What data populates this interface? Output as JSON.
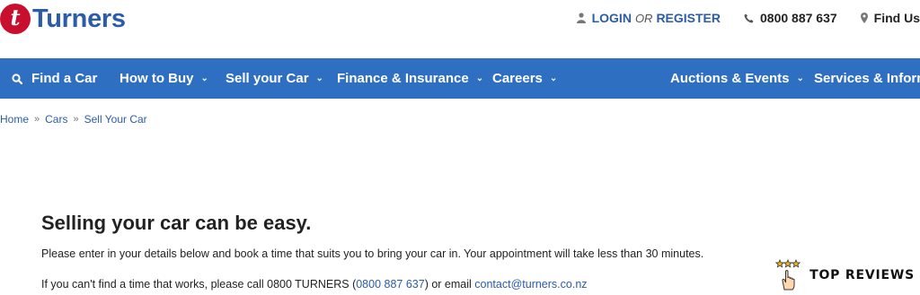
{
  "brand": {
    "name": "Turners",
    "mark": "t",
    "color": "#c8102e",
    "text_color": "#2a5caa"
  },
  "header": {
    "login": "LOGIN",
    "or": "OR",
    "register": "REGISTER",
    "phone": "0800 887 637",
    "find_us": "Find Us",
    "icons": [
      "user-icon",
      "phone-icon",
      "map-pin-icon"
    ]
  },
  "nav": {
    "color": "#2f6fc2",
    "items": [
      {
        "label": "Find a Car",
        "icon": "search-icon"
      },
      {
        "label": "How to Buy"
      },
      {
        "label": "Sell your Car"
      },
      {
        "label": "Finance & Insurance"
      },
      {
        "label": "Careers"
      },
      {
        "label": "Auctions & Events"
      },
      {
        "label": "Services & Informa"
      }
    ]
  },
  "breadcrumb": [
    "Home",
    "Cars",
    "Sell Your Car"
  ],
  "content": {
    "title": "Selling your car can be easy.",
    "intro": "Please enter in your details below and book a time that suits you to bring your car in. Your appointment will take less than 30 minutes.",
    "help_prefix": "If you can't find a time that works, please call 0800 TURNERS (",
    "help_phone": "0800 887 637",
    "help_middle": ") or email ",
    "help_email": "contact@turners.co.nz"
  },
  "reviews_badge": {
    "label": "TOP REVIEWS"
  }
}
